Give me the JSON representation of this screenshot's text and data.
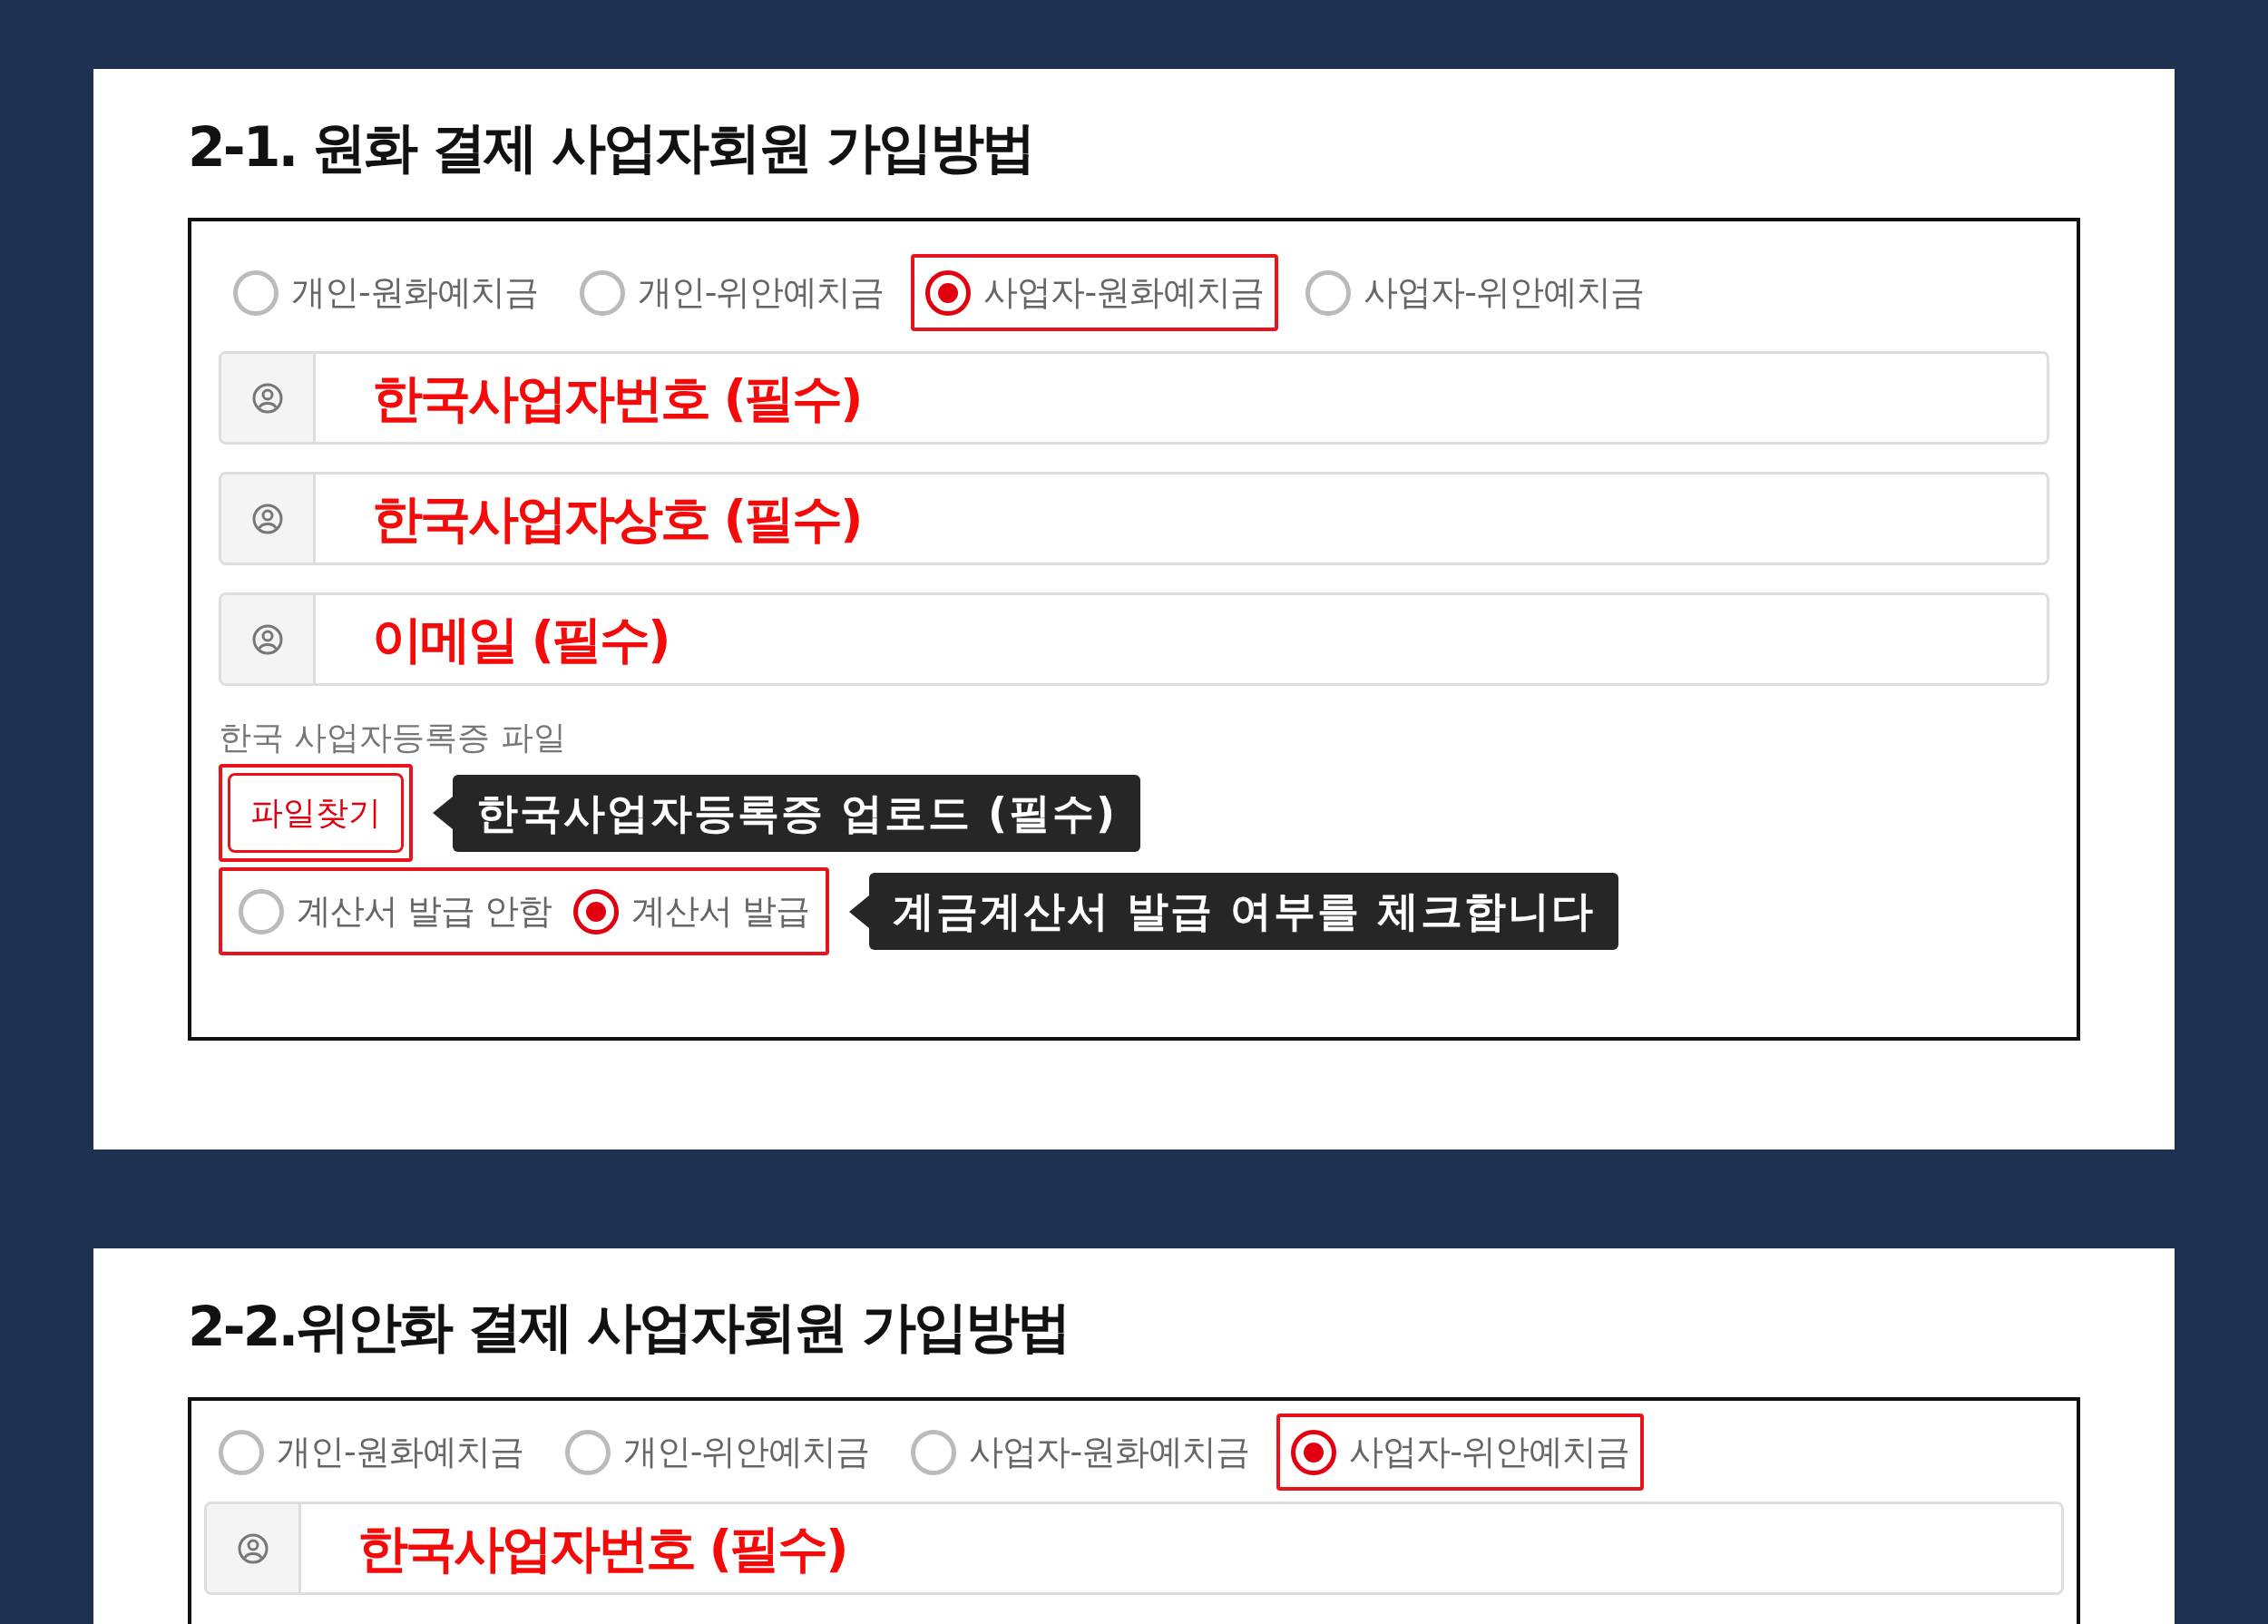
{
  "sections": [
    {
      "title": "2-1. 원화 결제 사업자회원 가입방법",
      "account_types": [
        {
          "label": "개인-원화예치금",
          "selected": false
        },
        {
          "label": "개인-위안예치금",
          "selected": false
        },
        {
          "label": "사업자-원화예치금",
          "selected": true
        },
        {
          "label": "사업자-위안예치금",
          "selected": false
        }
      ],
      "fields": [
        {
          "placeholder": "한국사업자번호 (필수)"
        },
        {
          "placeholder": "한국사업자상호 (필수)"
        },
        {
          "placeholder": "이메일 (필수)"
        }
      ],
      "file_label": "한국 사업자등록증 파일",
      "file_button": "파일찾기",
      "file_tooltip": "한국사업자등록증 업로드 (필수)",
      "invoice_options": [
        {
          "label": "계산서 발급 안함",
          "selected": false
        },
        {
          "label": "계산서 발급",
          "selected": true
        }
      ],
      "invoice_tooltip": "계금계산서 발급 여부를 체크합니다"
    },
    {
      "title": "2-2.위안화 결제 사업자회원 가입방법",
      "account_types": [
        {
          "label": "개인-원화예치금",
          "selected": false
        },
        {
          "label": "개인-위안예치금",
          "selected": false
        },
        {
          "label": "사업자-원화예치금",
          "selected": false
        },
        {
          "label": "사업자-위안예치금",
          "selected": true
        }
      ],
      "fields": [
        {
          "placeholder": "한국사업자번호 (필수)"
        }
      ]
    }
  ]
}
